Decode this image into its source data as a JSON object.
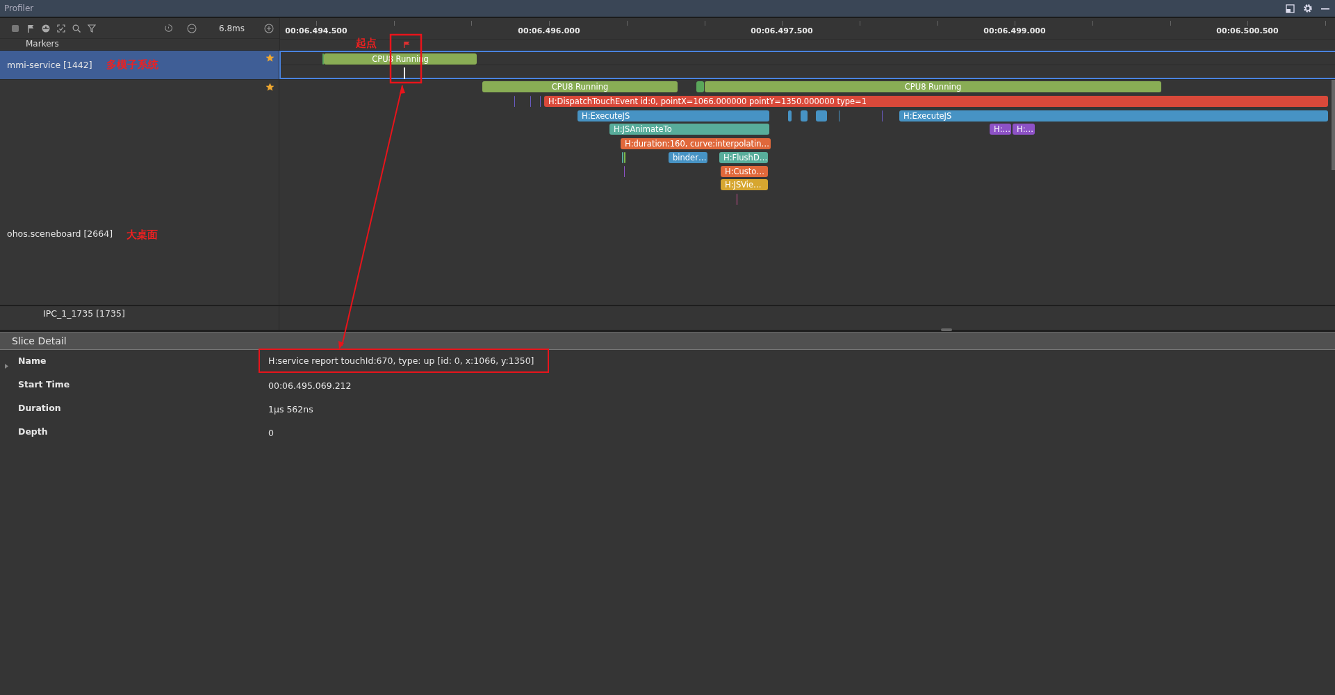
{
  "window": {
    "title": "Profiler"
  },
  "toolbar": {
    "zoom_level": "6.8ms"
  },
  "ruler": {
    "ticks": [
      "00:06.494.500",
      "00:06.496.000",
      "00:06.497.500",
      "00:06.499.000",
      "00:06.500.500"
    ]
  },
  "markers": {
    "label": "Markers",
    "flag_note": "起点"
  },
  "processes": [
    {
      "name": "mmi-service [1442]",
      "note": "多模子系统",
      "selected": true,
      "starred": true,
      "slices": [
        {
          "color": "#5aa65a"
        },
        {
          "label": "CPU8 Running",
          "color": "#89ad55"
        },
        {
          "color": "#f0f0f0"
        }
      ]
    },
    {
      "name": "ohos.sceneboard [2664]",
      "note": "大桌面",
      "selected": false,
      "starred": true,
      "slices": [
        {
          "label": "CPU8 Running",
          "color": "#89ad55"
        },
        {
          "color": "#5aa65a"
        },
        {
          "label": "CPU8 Running",
          "color": "#89ad55"
        },
        {
          "color": "#6a5cc4"
        },
        {
          "color": "#6a5cc4"
        },
        {
          "color": "#6a5cc4"
        },
        {
          "label": "H:DispatchTouchEvent id:0, pointX=1066.000000 pointY=1350.000000 type=1",
          "color": "#d9493a"
        },
        {
          "label": "H:ExecuteJS",
          "color": "#4793c4"
        },
        {
          "color": "#4793c4"
        },
        {
          "color": "#4793c4"
        },
        {
          "color": "#4793c4"
        },
        {
          "color": "#4793c4"
        },
        {
          "color": "#6a5cc4"
        },
        {
          "label": "H:ExecuteJS",
          "color": "#4793c4"
        },
        {
          "label": "H:JSAnimateTo",
          "color": "#58ad9b"
        },
        {
          "label": "H:…",
          "color": "#8d52c6"
        },
        {
          "label": "H:…",
          "color": "#8d52c6"
        },
        {
          "label": "H:duration:160, curve:interpolatin…",
          "color": "#e0683b"
        },
        {
          "color": "#58ad9b"
        },
        {
          "color": "#7ab848"
        },
        {
          "label": "binder…",
          "color": "#4793c4"
        },
        {
          "label": "H:FlushD…",
          "color": "#58ad9b"
        },
        {
          "color": "#8d52c6"
        },
        {
          "label": "H:Custo…",
          "color": "#e0683b"
        },
        {
          "label": "H:JSVie…",
          "color": "#d6a630"
        },
        {
          "color": "#d04f94"
        }
      ]
    },
    {
      "name": "IPC_1_1735 [1735]",
      "selected": false,
      "starred": false
    }
  ],
  "slice_detail": {
    "title": "Slice Detail",
    "fields": [
      {
        "label": "Name",
        "value": "H:service report touchId:670, type: up [id: 0, x:1066, y:1350]",
        "highlighted": true
      },
      {
        "label": "Start Time",
        "value": "00:06.495.069.212",
        "highlighted": false
      },
      {
        "label": "Duration",
        "value": "1μs 562ns",
        "highlighted": false
      },
      {
        "label": "Depth",
        "value": "0",
        "highlighted": false
      }
    ]
  }
}
